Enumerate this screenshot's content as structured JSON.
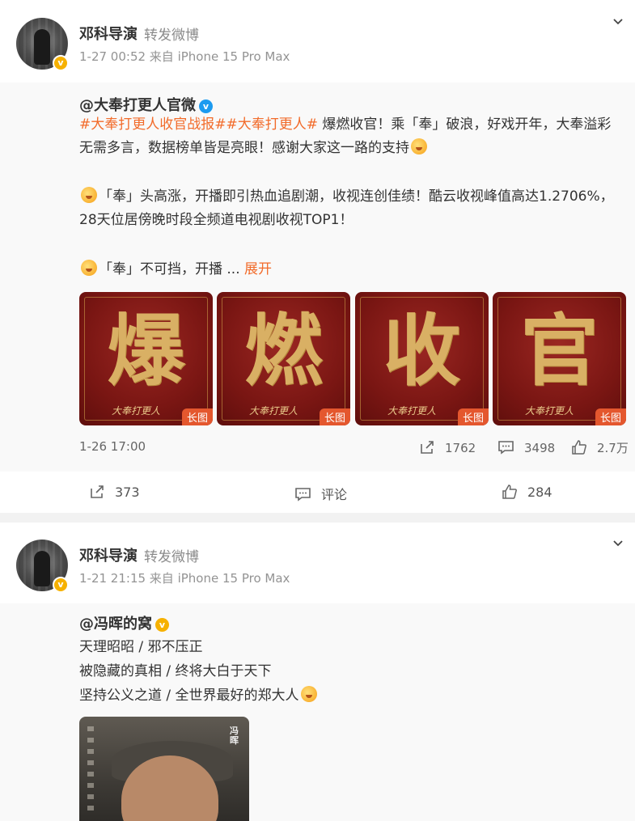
{
  "posts": [
    {
      "author": "邓科导演",
      "action": "转发微博",
      "meta": "1-27 00:52  来自 iPhone 15 Pro Max",
      "original": {
        "author": "@大奉打更人官微",
        "tags": "#大奉打更人收官战报##大奉打更人#",
        "line1_rest": " 爆燃收官！乘「奉」破浪，好戏开年，大奉溢彩",
        "line2": "无需多言，数据榜单皆是亮眼！感谢大家这一路的支持",
        "para2_line1": "「奉」头高涨，开播即引热血追剧潮，收视连创佳绩！酷云收视峰值高达1.2706%，",
        "para2_line2": "28天位居傍晚时段全频道电视剧收视TOP1！",
        "para3": "「奉」不可挡，开播 ... ",
        "expand": "展开",
        "images": [
          {
            "char": "爆",
            "caption": "大奉打更人",
            "badge": "长图"
          },
          {
            "char": "燃",
            "caption": "大奉打更人",
            "badge": "长图"
          },
          {
            "char": "收",
            "caption": "大奉打更人",
            "badge": "长图"
          },
          {
            "char": "官",
            "caption": "大奉打更人",
            "badge": "长图"
          }
        ],
        "date": "1-26 17:00",
        "reposts": "1762",
        "comments": "3498",
        "likes": "2.7万"
      },
      "footer": {
        "reposts": "373",
        "comment_label": "评论",
        "likes": "284"
      }
    },
    {
      "author": "邓科导演",
      "action": "转发微博",
      "meta": "1-21 21:15  来自 iPhone 15 Pro Max",
      "original": {
        "author": "@冯晖的窝",
        "lines": [
          "天理昭昭  / 邪不压正",
          "被隐藏的真相  / 终将大白于天下",
          "坚持公义之道 /  全世界最好的郑大人"
        ],
        "poster_name": "冯晖"
      }
    }
  ]
}
